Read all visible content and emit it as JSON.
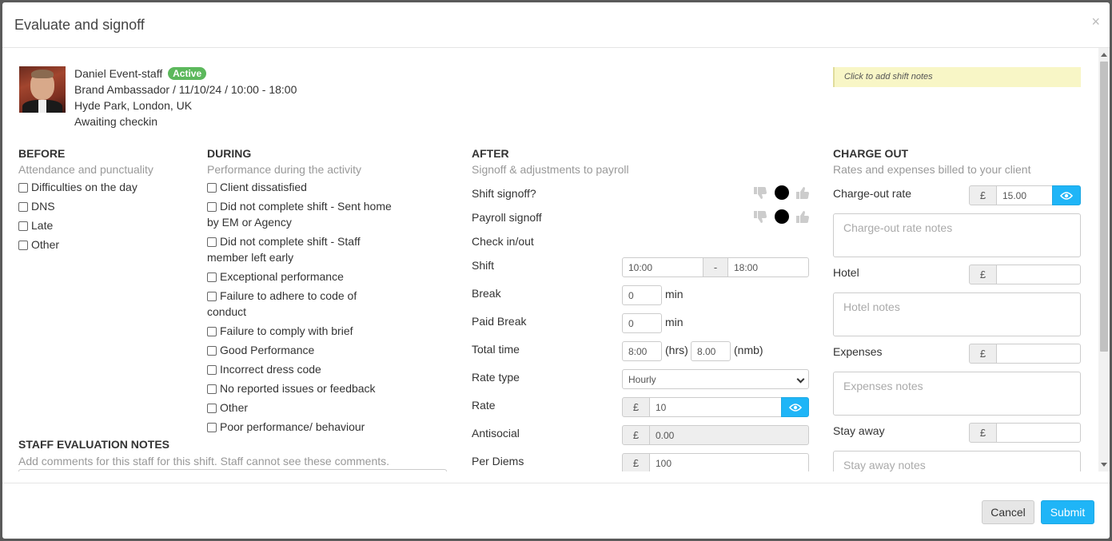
{
  "modal": {
    "title": "Evaluate and signoff",
    "close": "×"
  },
  "staff": {
    "name": "Daniel Event-staff",
    "status": "Active",
    "status_color": "#5cb85c",
    "role_line": "Brand Ambassador / 11/10/24 / 10:00 - 18:00",
    "location": "Hyde Park, London, UK",
    "state": "Awaiting checkin"
  },
  "shift_notes": {
    "placeholder": "Click to add shift notes"
  },
  "before": {
    "title": "BEFORE",
    "subtitle": "Attendance and punctuality",
    "items": [
      "Difficulties on the day",
      "DNS",
      "Late",
      "Other"
    ]
  },
  "during": {
    "title": "DURING",
    "subtitle": "Performance during the activity",
    "items": [
      "Client dissatisfied",
      "Did not complete shift - Sent home",
      "by EM or Agency",
      "Did not complete shift - Staff",
      "member left early",
      "Exceptional performance",
      "Failure to adhere to code of",
      "conduct",
      "Failure to comply with brief",
      "Good Performance",
      "Incorrect dress code",
      "No reported issues or feedback",
      "Other",
      "Poor performance/ behaviour"
    ]
  },
  "evaluation_notes": {
    "title": "STAFF EVALUATION NOTES",
    "subtitle": "Add comments for this staff for this shift. Staff cannot see these comments."
  },
  "after": {
    "title": "AFTER",
    "subtitle": "Signoff & adjustments to payroll",
    "shift_signoff": "Shift signoff?",
    "payroll_signoff": "Payroll signoff",
    "check_in_out": "Check in/out",
    "shift_label": "Shift",
    "shift_start": "10:00",
    "shift_sep": "-",
    "shift_end": "18:00",
    "break_label": "Break",
    "break_value": "0",
    "paid_break_label": "Paid Break",
    "paid_break_value": "0",
    "min_unit": "min",
    "total_time_label": "Total time",
    "total_hrs": "8:00",
    "hrs_unit": "(hrs)",
    "total_nmb": "8.00",
    "nmb_unit": "(nmb)",
    "rate_type_label": "Rate type",
    "rate_type_value": "Hourly",
    "rate_label": "Rate",
    "currency": "£",
    "rate_value": "10",
    "antisocial_label": "Antisocial",
    "antisocial_value": "0.00",
    "per_diems_label": "Per Diems",
    "per_diems_value": "100"
  },
  "charge_out": {
    "title": "CHARGE OUT",
    "subtitle": "Rates and expenses billed to your client",
    "currency": "£",
    "rate_label": "Charge-out rate",
    "rate_value": "15.00",
    "rate_notes_placeholder": "Charge-out rate notes",
    "hotel_label": "Hotel",
    "hotel_notes_placeholder": "Hotel notes",
    "expenses_label": "Expenses",
    "expenses_notes_placeholder": "Expenses notes",
    "stay_away_label": "Stay away",
    "stay_away_notes_placeholder": "Stay away notes"
  },
  "footer": {
    "cancel": "Cancel",
    "submit": "Submit"
  },
  "colors": {
    "accent": "#1fb5f7",
    "notes_bg": "#f8f6c6"
  }
}
